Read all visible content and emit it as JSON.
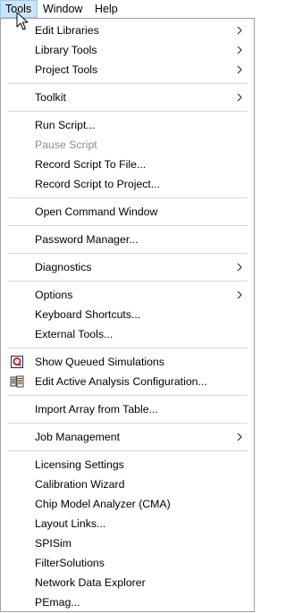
{
  "menubar": {
    "items": [
      {
        "label": "Tools"
      },
      {
        "label": "Window"
      },
      {
        "label": "Help"
      }
    ]
  },
  "menu": {
    "items": [
      {
        "label": "Edit Libraries",
        "submenu": true
      },
      {
        "label": "Library Tools",
        "submenu": true
      },
      {
        "label": "Project Tools",
        "submenu": true
      },
      {
        "label": "Toolkit",
        "submenu": true
      },
      {
        "label": "Run Script..."
      },
      {
        "label": "Pause Script",
        "disabled": true
      },
      {
        "label": "Record Script To File..."
      },
      {
        "label": "Record Script to Project..."
      },
      {
        "label": "Open Command Window"
      },
      {
        "label": "Password Manager..."
      },
      {
        "label": "Diagnostics",
        "submenu": true
      },
      {
        "label": "Options",
        "submenu": true
      },
      {
        "label": "Keyboard Shortcuts..."
      },
      {
        "label": "External Tools..."
      },
      {
        "label": "Show Queued Simulations",
        "icon": "queue-icon"
      },
      {
        "label": "Edit Active Analysis Configuration...",
        "icon": "analysis-config-icon"
      },
      {
        "label": "Import Array from Table..."
      },
      {
        "label": "Job Management",
        "submenu": true
      },
      {
        "label": "Licensing Settings"
      },
      {
        "label": "Calibration Wizard"
      },
      {
        "label": "Chip Model Analyzer (CMA)"
      },
      {
        "label": "Layout Links..."
      },
      {
        "label": "SPISim"
      },
      {
        "label": "FilterSolutions"
      },
      {
        "label": "Network Data Explorer"
      },
      {
        "label": "PEmag..."
      }
    ]
  }
}
